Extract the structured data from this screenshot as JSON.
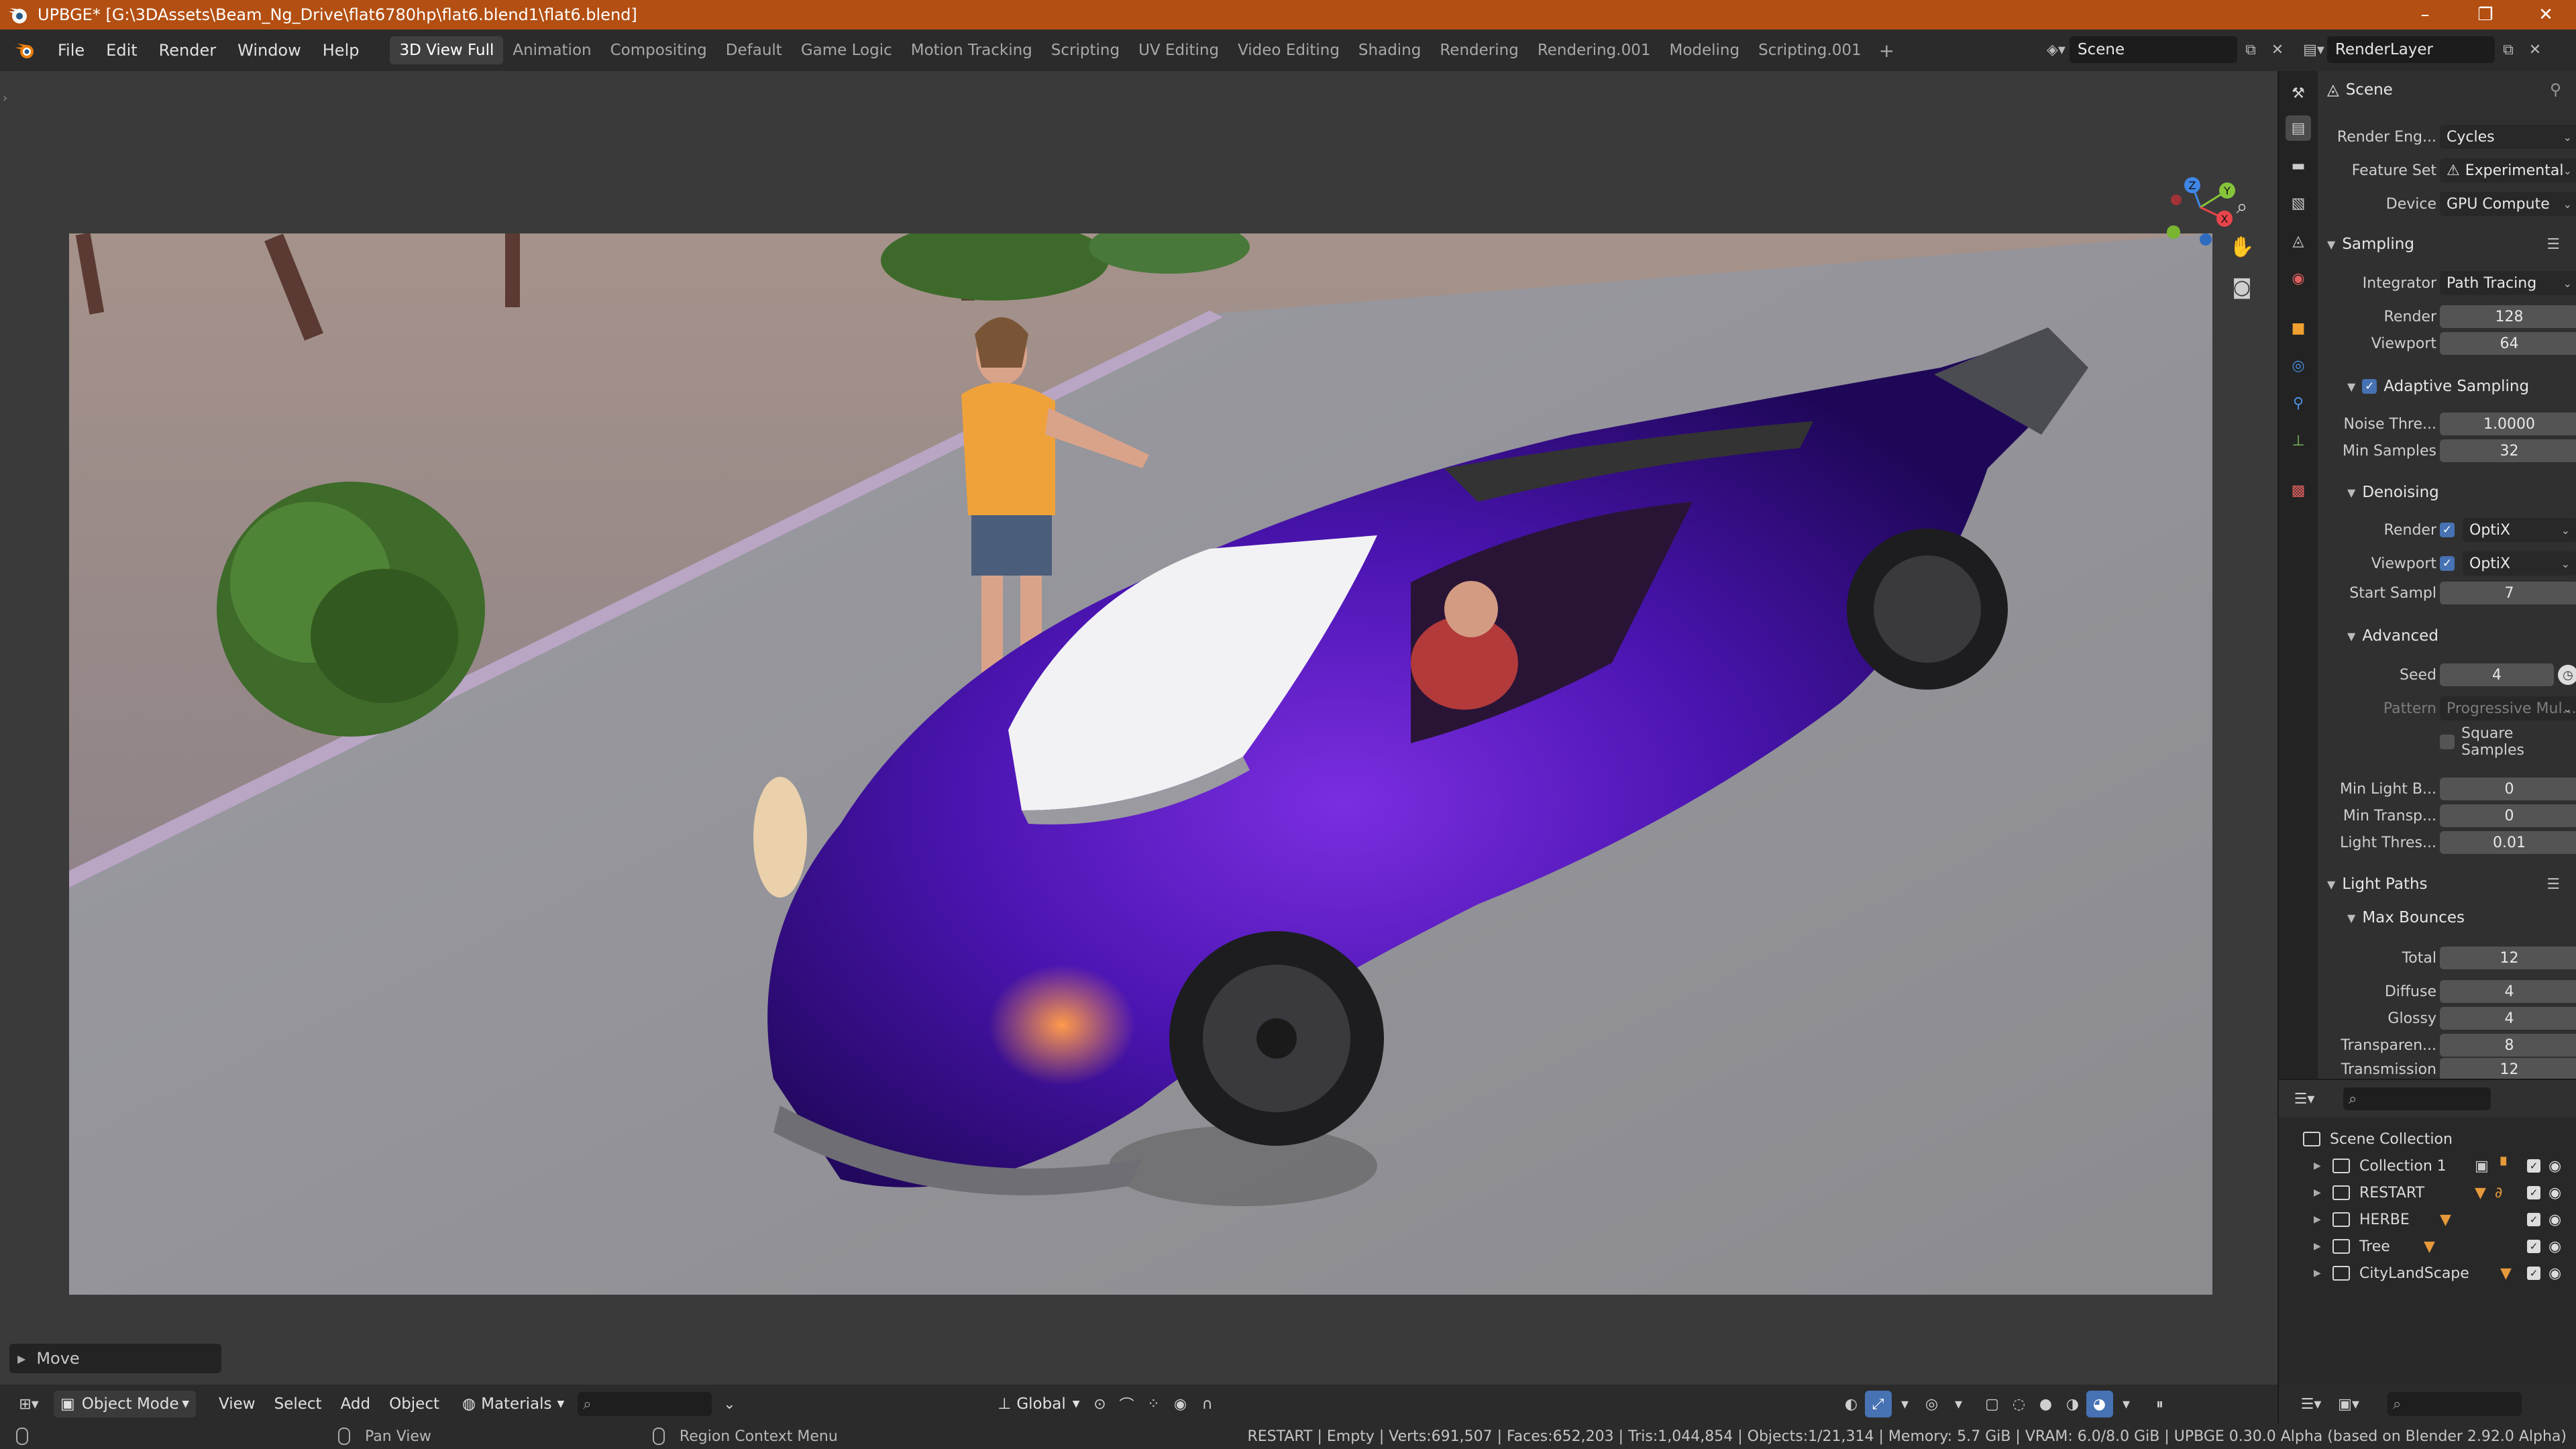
{
  "window": {
    "title": "UPBGE* [G:\\3DAssets\\Beam_Ng_Drive\\flat6780hp\\flat6.blend1\\flat6.blend]",
    "controls": [
      "–",
      "❐",
      "✕"
    ]
  },
  "menu": [
    "File",
    "Edit",
    "Render",
    "Window",
    "Help"
  ],
  "workspaces": {
    "active": "3D View Full",
    "tabs": [
      "3D View Full",
      "Animation",
      "Compositing",
      "Default",
      "Game Logic",
      "Motion Tracking",
      "Scripting",
      "UV Editing",
      "Video Editing",
      "Shading",
      "Rendering",
      "Rendering.001",
      "Modeling",
      "Scripting.001"
    ],
    "add_label": "+"
  },
  "scene_selector": {
    "scene": "Scene",
    "view_layer": "RenderLayer"
  },
  "viewport": {
    "last_operator": "Move",
    "header": {
      "mode": "Object Mode",
      "menus": [
        "View",
        "Select",
        "Add",
        "Object"
      ],
      "shading_dropdown": "Materials",
      "transform_orientation": "Global"
    },
    "gizmo_axes": {
      "x": "X",
      "y": "Y",
      "z": "Z"
    },
    "colors": {
      "x_axis": "#e8444b",
      "y_axis": "#86c53a",
      "z_axis": "#3f87e6"
    }
  },
  "status": {
    "hint_left": "Pan View",
    "hint_middle": "Region Context Menu",
    "stats": "RESTART | Empty | Verts:691,507 | Faces:652,203 | Tris:1,044,854 | Objects:1/21,314 | Memory: 5.7 GiB | VRAM: 6.0/8.0 GiB | UPBGE 0.30.0 Alpha (based on Blender 2.92.0 Alpha)"
  },
  "properties": {
    "header": "Scene",
    "render_engine": {
      "label": "Render Eng...",
      "value": "Cycles"
    },
    "feature_set": {
      "label": "Feature Set",
      "value": "Experimental"
    },
    "device": {
      "label": "Device",
      "value": "GPU Compute"
    },
    "sampling": {
      "title": "Sampling",
      "integrator": {
        "label": "Integrator",
        "value": "Path Tracing"
      },
      "render": {
        "label": "Render",
        "value": "128"
      },
      "viewport": {
        "label": "Viewport",
        "value": "64"
      },
      "adaptive": {
        "title": "Adaptive Sampling",
        "checked": true
      },
      "noise_threshold": {
        "label": "Noise Thre...",
        "value": "1.0000"
      },
      "min_samples": {
        "label": "Min Samples",
        "value": "32"
      },
      "denoising": {
        "title": "Denoising",
        "render": {
          "label": "Render",
          "value": "OptiX",
          "checked": true
        },
        "viewport": {
          "label": "Viewport",
          "value": "OptiX",
          "checked": true
        },
        "start_sample": {
          "label": "Start Sampl",
          "value": "7"
        }
      },
      "advanced": {
        "title": "Advanced",
        "seed": {
          "label": "Seed",
          "value": "4"
        },
        "pattern": {
          "label": "Pattern",
          "value": "Progressive Mul..."
        },
        "square_samples": {
          "label": "Square Samples",
          "checked": false
        },
        "min_light_bounces": {
          "label": "Min Light B...",
          "value": "0"
        },
        "min_transparent": {
          "label": "Min Transp...",
          "value": "0"
        },
        "light_threshold": {
          "label": "Light Thres...",
          "value": "0.01"
        }
      }
    },
    "light_paths": {
      "title": "Light Paths",
      "max_bounces": {
        "title": "Max Bounces",
        "total": {
          "label": "Total",
          "value": "12"
        },
        "diffuse": {
          "label": "Diffuse",
          "value": "4"
        },
        "glossy": {
          "label": "Glossy",
          "value": "4"
        },
        "transparency": {
          "label": "Transparen...",
          "value": "8"
        },
        "transmission": {
          "label": "Transmission",
          "value": "12"
        }
      }
    }
  },
  "outliner": {
    "root": "Scene Collection",
    "items": [
      {
        "name": "Collection 1"
      },
      {
        "name": "RESTART"
      },
      {
        "name": "HERBE"
      },
      {
        "name": "Tree"
      },
      {
        "name": "CityLandScape"
      }
    ]
  }
}
